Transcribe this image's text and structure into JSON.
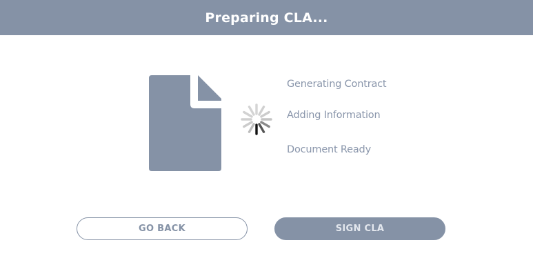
{
  "header": {
    "title": "Preparing CLA..."
  },
  "document": {
    "icon": "document-icon"
  },
  "spinner": {
    "icon": "loading-spinner-icon"
  },
  "steps": [
    {
      "label": "Generating Contract"
    },
    {
      "label": "Adding Information"
    },
    {
      "label": "Document Ready"
    }
  ],
  "buttons": {
    "go_back_label": "GO BACK",
    "sign_label": "SIGN CLA"
  },
  "colors": {
    "accent": "#8592a6",
    "step_text": "#8a96ab",
    "background": "#ffffff"
  }
}
